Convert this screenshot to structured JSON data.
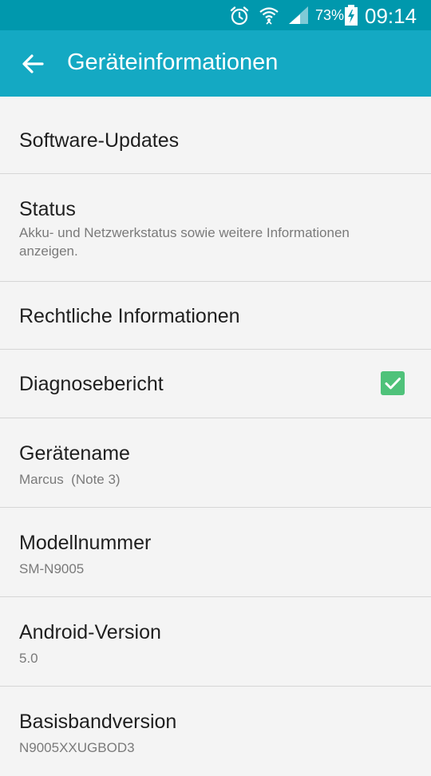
{
  "status_bar": {
    "battery_percent": "73%",
    "time": "09:14",
    "icons": [
      "alarm-icon",
      "wifi-icon",
      "signal-icon",
      "battery-charging-icon"
    ]
  },
  "app_bar": {
    "title": "Geräteinformationen",
    "back_icon": "arrow-back-icon",
    "color": "#14a9c3"
  },
  "items": [
    {
      "title": "Software-Updates"
    },
    {
      "title": "Status",
      "subtitle": "Akku- und Netzwerkstatus sowie weitere Informationen anzeigen."
    },
    {
      "title": "Rechtliche Informationen"
    },
    {
      "title": "Diagnosebericht",
      "checked": true
    },
    {
      "title": "Gerätename",
      "subtitle": "Marcus  (Note 3)"
    },
    {
      "title": "Modellnummer",
      "subtitle": "SM-N9005"
    },
    {
      "title": "Android-Version",
      "subtitle": "5.0"
    },
    {
      "title": "Basisbandversion",
      "subtitle": "N9005XXUGBOD3"
    }
  ],
  "checkbox_color": "#4fc27a"
}
